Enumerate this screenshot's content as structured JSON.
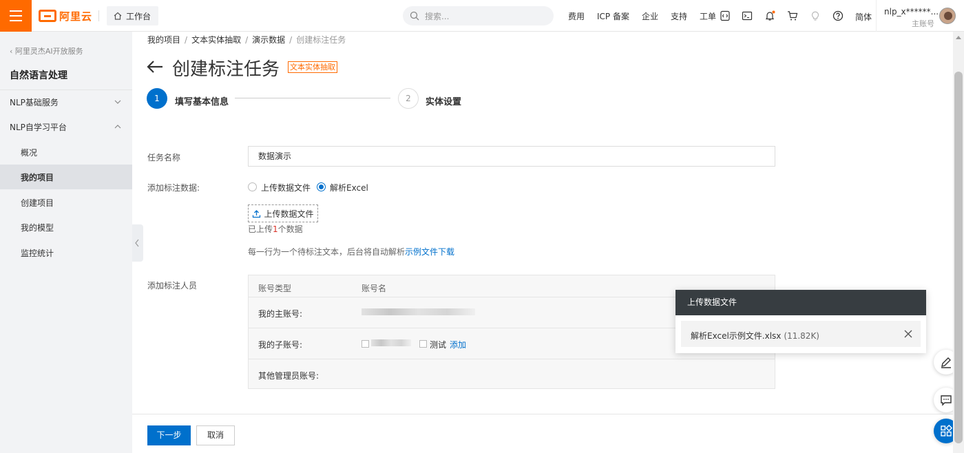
{
  "header": {
    "logo_text": "阿里云",
    "workbench_label": "工作台",
    "search_placeholder": "搜索...",
    "links": [
      "费用",
      "ICP 备案",
      "企业",
      "支持",
      "工单"
    ],
    "lang_label": "简体",
    "username": "nlp_x******...",
    "user_role": "主账号",
    "icons": [
      "code-icon",
      "terminal-icon",
      "bell-icon",
      "cart-icon",
      "bulb-icon",
      "help-icon"
    ]
  },
  "sidebar": {
    "back_label": "阿里灵杰AI开放服务",
    "title": "自然语言处理",
    "items": [
      {
        "label": "NLP基础服务",
        "type": "group",
        "expanded": false
      },
      {
        "label": "NLP自学习平台",
        "type": "group",
        "expanded": true
      },
      {
        "label": "概况",
        "type": "sub"
      },
      {
        "label": "我的项目",
        "type": "sub",
        "active": true
      },
      {
        "label": "创建项目",
        "type": "sub"
      },
      {
        "label": "我的模型",
        "type": "sub"
      },
      {
        "label": "监控统计",
        "type": "sub"
      }
    ]
  },
  "breadcrumb": [
    "我的项目",
    "文本实体抽取",
    "演示数据",
    "创建标注任务"
  ],
  "page": {
    "title": "创建标注任务",
    "tag": "文本实体抽取"
  },
  "steps": [
    {
      "num": "1",
      "label": "填写基本信息",
      "active": true
    },
    {
      "num": "2",
      "label": "实体设置",
      "active": false
    }
  ],
  "form": {
    "task_name_label": "任务名称",
    "task_name_value": "数据演示",
    "data_label": "添加标注数据:",
    "radio_upload": "上传数据文件",
    "radio_excel": "解析Excel",
    "selected": "解析Excel",
    "upload_button": "上传数据文件",
    "uploaded_prefix": "已上传",
    "uploaded_count": "1",
    "uploaded_suffix": "个数据",
    "hint_text": "每一行为一个待标注文本，后台将自动解析",
    "hint_link": "示例文件下载",
    "annotators_label": "添加标注人员",
    "table_headers": [
      "账号类型",
      "账号名"
    ],
    "rows": [
      {
        "label": "我的主账号:"
      },
      {
        "label": "我的子账号:",
        "checkbox_label": "测试",
        "add_link": "添加"
      },
      {
        "label": "其他管理员账号:"
      }
    ]
  },
  "buttons": {
    "next": "下一步",
    "cancel": "取消"
  },
  "upload_popup": {
    "title": "上传数据文件",
    "file_name": "解析Excel示例文件.xlsx",
    "file_size": "(11.82K)"
  },
  "colors": {
    "brand": "#ff6a00",
    "primary": "#0070cc",
    "sidebar_bg": "#f2f3f5",
    "popup_header": "#373d41"
  }
}
